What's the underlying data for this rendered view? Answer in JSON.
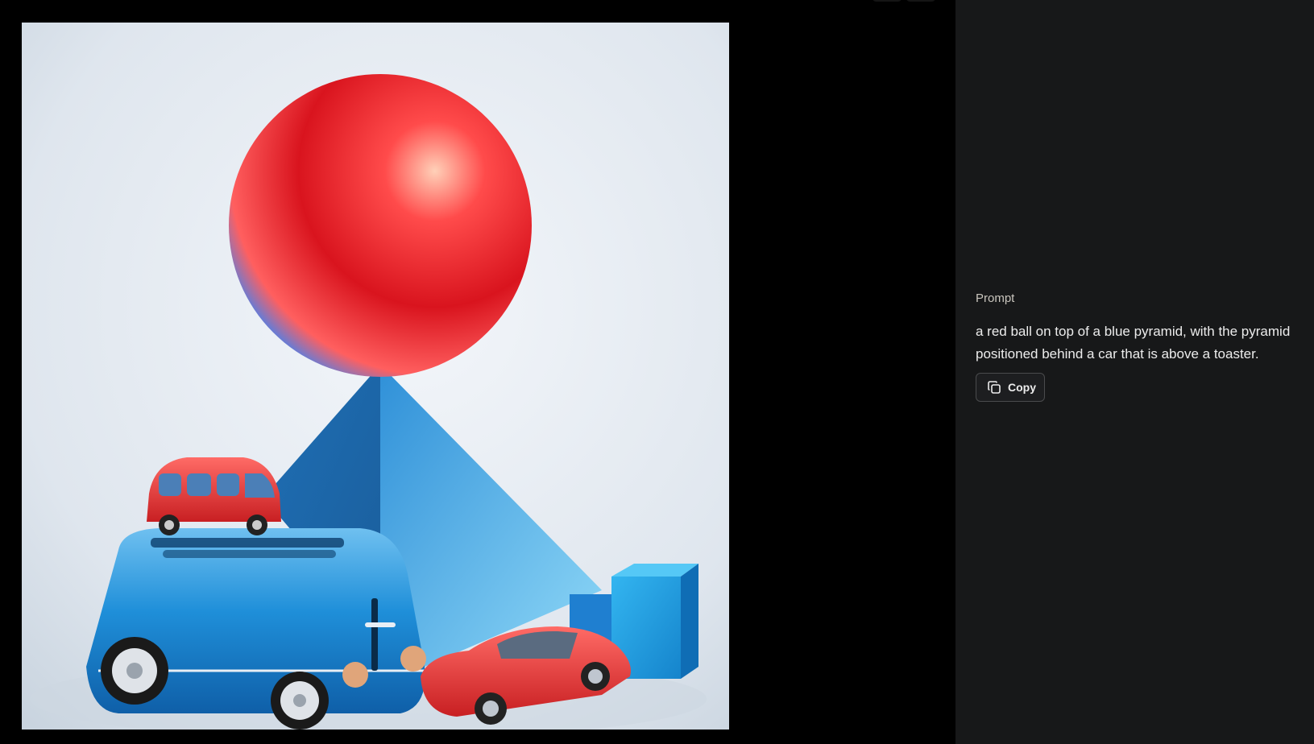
{
  "image": {
    "alt": "a red ball on top of a blue pyramid, with the pyramid positioned behind a car that is above a toaster."
  },
  "panel": {
    "prompt_label": "Prompt",
    "prompt_text": "a red ball on top of a blue pyramid, with the pyramid positioned behind a car that is above a toaster.",
    "copy_label": "Copy",
    "copy_icon": "copy-icon"
  },
  "colors": {
    "page_background": "#000000",
    "panel_background": "#171819",
    "text_primary": "#ececec",
    "text_secondary": "#c9c5bd",
    "button_border": "#4a4b4d"
  }
}
